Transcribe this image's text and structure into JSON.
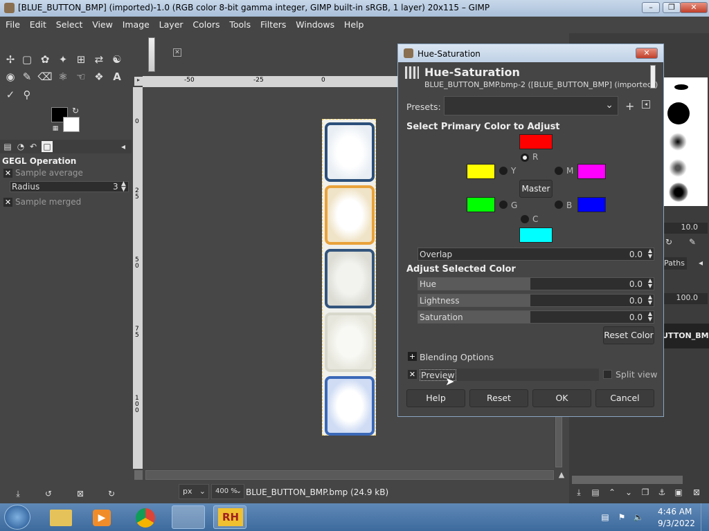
{
  "window": {
    "title": "[BLUE_BUTTON_BMP] (imported)-1.0 (RGB color 8-bit gamma integer, GIMP built-in sRGB, 1 layer) 20x115 – GIMP",
    "minimize_icon": "minimize-icon",
    "maximize_icon": "maximize-icon",
    "close_icon": "close-icon"
  },
  "menubar": [
    "File",
    "Edit",
    "Select",
    "View",
    "Image",
    "Layer",
    "Colors",
    "Tools",
    "Filters",
    "Windows",
    "Help"
  ],
  "tool_options": {
    "title": "GEGL Operation",
    "sample_average": "Sample average",
    "radius_label": "Radius",
    "radius_value": "3",
    "sample_merged": "Sample merged"
  },
  "rulers": {
    "top_ticks": [
      "-50",
      "-25",
      "0"
    ],
    "left_ticks": [
      "0",
      "2\n5",
      "5\n0",
      "7\n5",
      "1\n0\n0"
    ]
  },
  "statusbar": {
    "unit": "px",
    "zoom": "400 %",
    "file_info": "BLUE_BUTTON_BMP.bmp (24.9 kB)"
  },
  "right_dock": {
    "size_value": "10.0",
    "paths_tab": "Paths",
    "opacity_value": "100.0",
    "layer_name": "UTTON_BMP"
  },
  "dialog": {
    "window_title": "Hue-Saturation",
    "header_title": "Hue-Saturation",
    "header_subtitle": "BLUE_BUTTON_BMP.bmp-2 ([BLUE_BUTTON_BMP] (imported))",
    "presets_label": "Presets:",
    "primary_section": "Select Primary Color to Adjust",
    "colors": {
      "R": "R",
      "Y": "Y",
      "M": "M",
      "G": "G",
      "B": "B",
      "C": "C",
      "red": "#ff0000",
      "yellow": "#ffff00",
      "magenta": "#ff00ff",
      "green": "#00ff00",
      "blue": "#0000ff",
      "cyan": "#00ffff"
    },
    "master_button": "Master",
    "overlap_label": "Overlap",
    "overlap_value": "0.0",
    "adjust_section": "Adjust Selected Color",
    "hue_label": "Hue",
    "hue_value": "0.0",
    "lightness_label": "Lightness",
    "lightness_value": "0.0",
    "saturation_label": "Saturation",
    "saturation_value": "0.0",
    "reset_color_button": "Reset Color",
    "blending_options": "Blending Options",
    "preview_label": "Preview",
    "split_view_label": "Split view",
    "help_button": "Help",
    "reset_button": "Reset",
    "ok_button": "OK",
    "cancel_button": "Cancel"
  },
  "taskbar": {
    "time": "4:46 AM",
    "date": "9/3/2022"
  }
}
